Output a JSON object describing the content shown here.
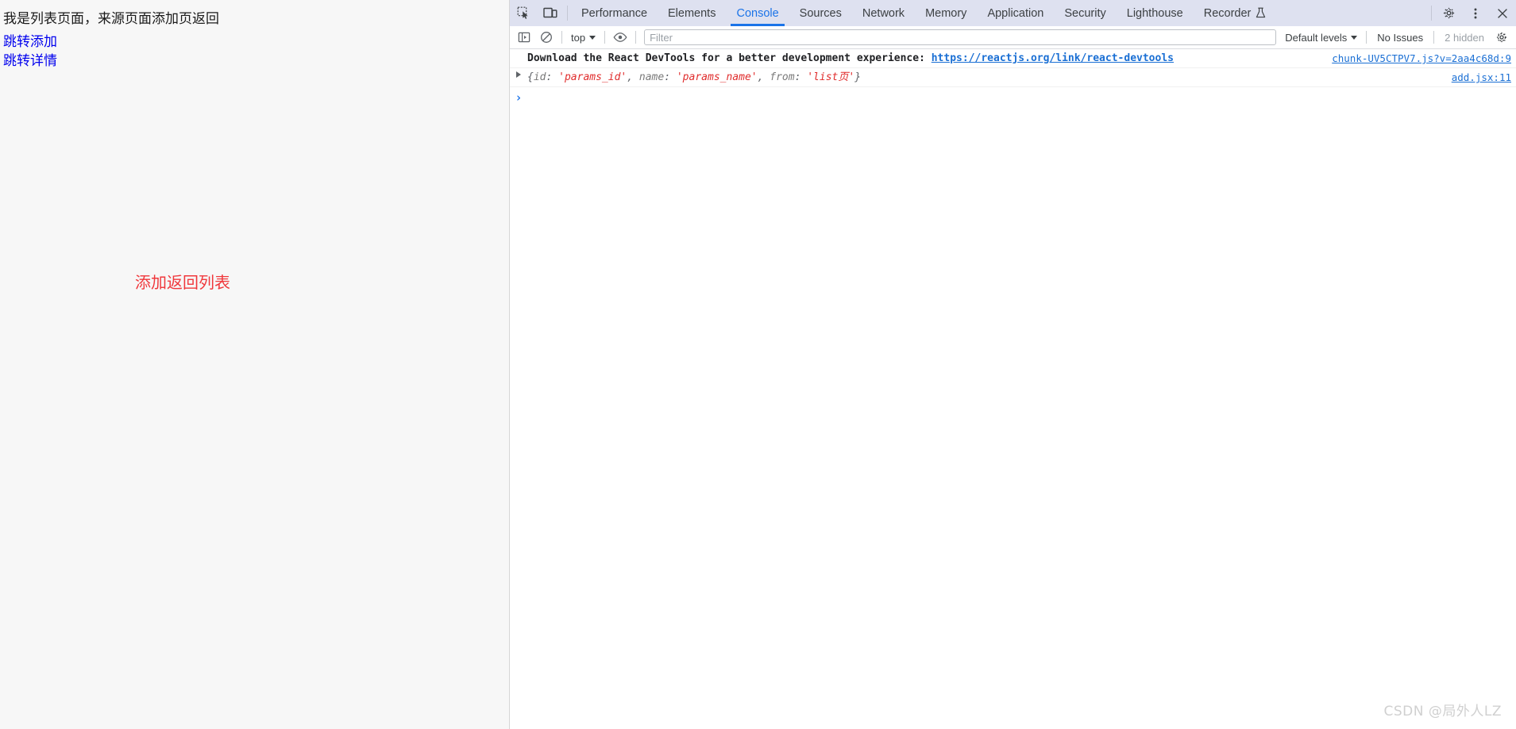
{
  "webpage": {
    "heading": "我是列表页面，来源页面添加页返回",
    "links": [
      {
        "label": "跳转添加",
        "name": "jump-add-link"
      },
      {
        "label": "跳转详情",
        "name": "jump-detail-link"
      }
    ],
    "red_notice": "添加返回列表",
    "colors": {
      "background": "#f7f7f7",
      "link": "#0000ee",
      "notice": "#f0383c"
    }
  },
  "devtools": {
    "tabs": [
      {
        "label": "Performance",
        "active": false
      },
      {
        "label": "Elements",
        "active": false
      },
      {
        "label": "Console",
        "active": true
      },
      {
        "label": "Sources",
        "active": false
      },
      {
        "label": "Network",
        "active": false
      },
      {
        "label": "Memory",
        "active": false
      },
      {
        "label": "Application",
        "active": false
      },
      {
        "label": "Security",
        "active": false
      },
      {
        "label": "Lighthouse",
        "active": false
      },
      {
        "label": "Recorder",
        "active": false,
        "icon": "flask-icon"
      }
    ],
    "tab_icons": {
      "inspect": "inspect-element-icon",
      "device": "device-toolbar-icon",
      "settings": "gear-icon",
      "more": "more-options-icon",
      "close": "close-icon"
    },
    "accent_color": "#1a73e8",
    "tabbar_background": "#dee1f0",
    "console_toolbar": {
      "sidebar_icon": "console-sidebar-icon",
      "clear_icon": "clear-console-icon",
      "context_label": "top",
      "eye_icon": "live-expression-eye-icon",
      "filter_placeholder": "Filter",
      "filter_value": "",
      "levels_label": "Default levels",
      "issues_label": "No Issues",
      "hidden_label": "2 hidden",
      "settings_icon": "console-settings-gear-icon"
    },
    "messages": [
      {
        "kind": "info-bold",
        "text_before": "Download the React DevTools for a better development experience: ",
        "link_text": "https://reactjs.org/link/react-devtools",
        "source": "chunk-UV5CTPV7.js?v=2aa4c68d:9"
      },
      {
        "kind": "object",
        "expandable": true,
        "object_open": "{",
        "entries": [
          {
            "key": "id",
            "value": "'params_id'"
          },
          {
            "key": "name",
            "value": "'params_name'"
          },
          {
            "key": "from",
            "value": "'list页'"
          }
        ],
        "object_close": "}",
        "source": "add.jsx:11"
      }
    ],
    "prompt": {
      "chevron": "›",
      "value": "",
      "placeholder": ""
    }
  },
  "watermark": "CSDN @局外人LZ"
}
